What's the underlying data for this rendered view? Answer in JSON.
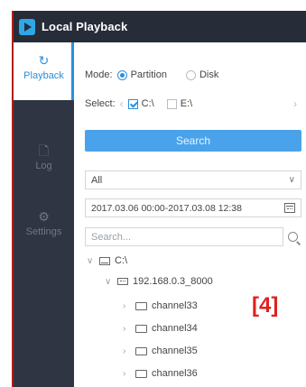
{
  "window": {
    "title": "Local Playback"
  },
  "sidebar": {
    "items": [
      {
        "label": "Playback",
        "icon": "refresh-icon",
        "active": true
      },
      {
        "label": "Log",
        "icon": "document-icon",
        "active": false
      },
      {
        "label": "Settings",
        "icon": "gear-icon",
        "active": false
      }
    ]
  },
  "mode": {
    "label": "Mode:",
    "options": [
      {
        "label": "Partition",
        "checked": true
      },
      {
        "label": "Disk",
        "checked": false
      }
    ]
  },
  "select": {
    "label": "Select:",
    "drives": [
      {
        "label": "C:\\",
        "checked": true
      },
      {
        "label": "E:\\",
        "checked": false
      }
    ]
  },
  "search_button": {
    "label": "Search"
  },
  "filter": {
    "selected": "All"
  },
  "date_range": {
    "value": "2017.03.06 00:00-2017.03.08 12:38"
  },
  "search": {
    "placeholder": "Search..."
  },
  "tree": {
    "drive": "C:\\",
    "device": "192.168.0.3_8000",
    "channels": [
      "channel33",
      "channel34",
      "channel35",
      "channel36"
    ]
  },
  "annotation": {
    "label": "[4]"
  },
  "colors": {
    "accent": "#2b8fdc",
    "titlebar": "#262d38",
    "sidebar": "#2f3542",
    "annotation": "#e02020"
  }
}
